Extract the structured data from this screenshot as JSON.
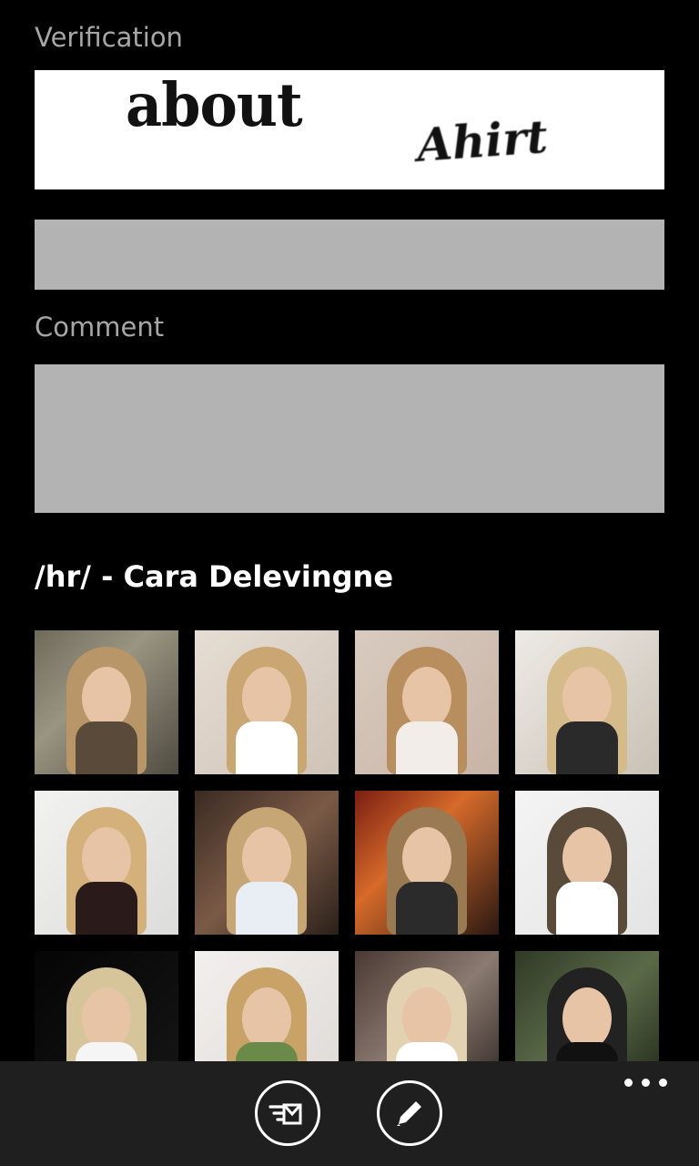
{
  "form": {
    "verification_label": "Verification",
    "captcha_words": [
      "about",
      "Ahirt"
    ],
    "verification_value": "",
    "comment_label": "Comment",
    "comment_value": ""
  },
  "gallery": {
    "title": "/hr/ - Cara Delevingne",
    "thumbnail_count": 12
  },
  "appbar": {
    "buttons": [
      "refresh-list-icon",
      "compose-pencil-icon"
    ],
    "more_icon": "ellipsis-icon"
  }
}
